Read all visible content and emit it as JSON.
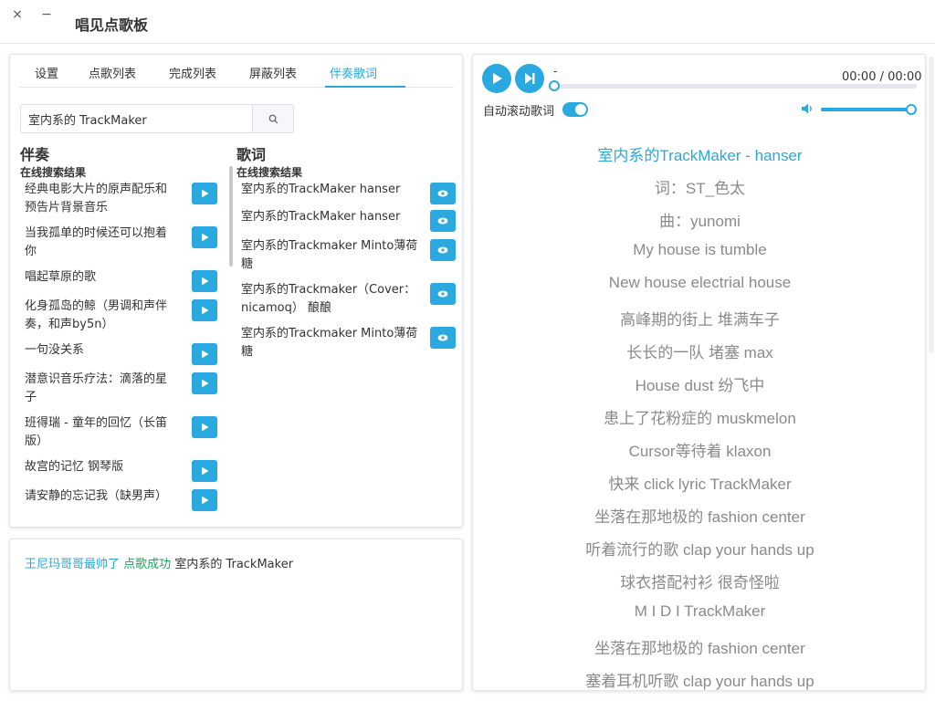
{
  "window": {
    "close": "×",
    "minimize": "−",
    "title": "唱见点歌板"
  },
  "tabs": [
    "设置",
    "点歌列表",
    "完成列表",
    "屏蔽列表",
    "伴奏歌词"
  ],
  "active_tab": "伴奏歌词",
  "search": {
    "value": "室内系的 TrackMaker"
  },
  "accompaniment": {
    "title": "伴奏",
    "subtitle": "在线搜索结果",
    "items": [
      {
        "l1": "经典电影大片的原声配乐和",
        "l2": "预告片背景音乐"
      },
      {
        "l1": "当我孤单的时候还可以抱着",
        "l2": "你"
      },
      {
        "l1": "唱起草原的歌",
        "l2": ""
      },
      {
        "l1": "化身孤岛的鲸（男调和声伴",
        "l2": "奏，和声by5n）"
      },
      {
        "l1": "一句没关系",
        "l2": ""
      },
      {
        "l1": "潜意识音乐疗法：滴落的星",
        "l2": "子"
      },
      {
        "l1": "班得瑞 - 童年的回忆（长笛",
        "l2": "版）"
      },
      {
        "l1": "故宫的记忆 钢琴版",
        "l2": ""
      },
      {
        "l1": "请安静的忘记我（缺男声）",
        "l2": ""
      }
    ]
  },
  "lyrics_search": {
    "title": "歌词",
    "subtitle": "在线搜索结果",
    "items": [
      {
        "l1": "室内系的TrackMaker hanser",
        "l2": ""
      },
      {
        "l1": "室内系的TrackMaker hanser",
        "l2": ""
      },
      {
        "l1": "室内系的Trackmaker Minto薄荷",
        "l2": "糖"
      },
      {
        "l1": "室内系的Trackmaker（Cover：",
        "l2": "nicamoq） 酿酿"
      },
      {
        "l1": "室内系的Trackmaker Minto薄荷",
        "l2": "糖"
      }
    ]
  },
  "log": {
    "user": "王尼玛哥哥最帅了",
    "status": "点歌成功",
    "song": "室内系的 TrackMaker"
  },
  "player": {
    "track_name": "-",
    "time": "00:00 / 00:00",
    "progress": 0,
    "autoscroll_label": "自动滚动歌词",
    "autoscroll_on": true,
    "volume": 1.0
  },
  "lyrics": [
    "室内系的TrackMaker - hanser",
    "词：ST_色太",
    "曲：yunomi",
    "My house is tumble",
    "New house electrial house",
    "高峰期的街上 堆满车子",
    "长长的一队 堵塞 max",
    "House dust 纷飞中",
    "患上了花粉症的 muskmelon",
    "Cursor等待着 klaxon",
    "快来 click lyric TrackMaker",
    "坐落在那地极的 fashion center",
    "听着流行的歌 clap your hands up",
    "球衣搭配衬衫 很奇怪啦",
    "M I D I TrackMaker",
    "坐落在那地极的 fashion center",
    "塞着耳机听歌 clap your hands up"
  ],
  "colors": {
    "accent": "#2aa8e0",
    "success": "#19a85a"
  }
}
